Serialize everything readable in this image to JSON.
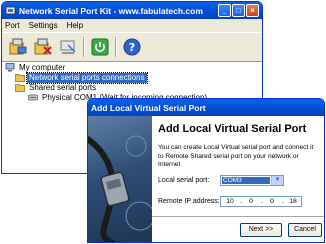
{
  "main_window": {
    "title": "Network Serial Port Kit - www.fabulatech.com",
    "menu": [
      "Port",
      "Settings",
      "Help"
    ],
    "toolbar_icons": [
      "add-port-icon",
      "remove-port-icon",
      "connect-icon",
      "power-icon",
      "help-icon"
    ],
    "tree": {
      "root": "My computer",
      "items": [
        {
          "label": "Network serial ports connections",
          "selected": true
        },
        {
          "label": "Shared serial ports"
        },
        {
          "label": "Physical COM1 (Wait for incoming connection)"
        }
      ]
    }
  },
  "dialog": {
    "title": "Add Local Virtual Serial Port",
    "heading": "Add Local Virtual Serial Port",
    "description": "You can create Local Virtual serial port and connect it to Remote Shared serial port on your network or Internet",
    "local_port_label": "Local serial port:",
    "local_port_value": "COM3",
    "remote_ip_label": "Remote IP address:",
    "remote_ip": [
      "10",
      "0",
      "0",
      "18"
    ],
    "next_button": "Next >>",
    "cancel_button": "Cancel"
  },
  "colors": {
    "titlebar": "#0551d6",
    "selection": "#316ac5",
    "window_bg": "#ece9d8"
  }
}
